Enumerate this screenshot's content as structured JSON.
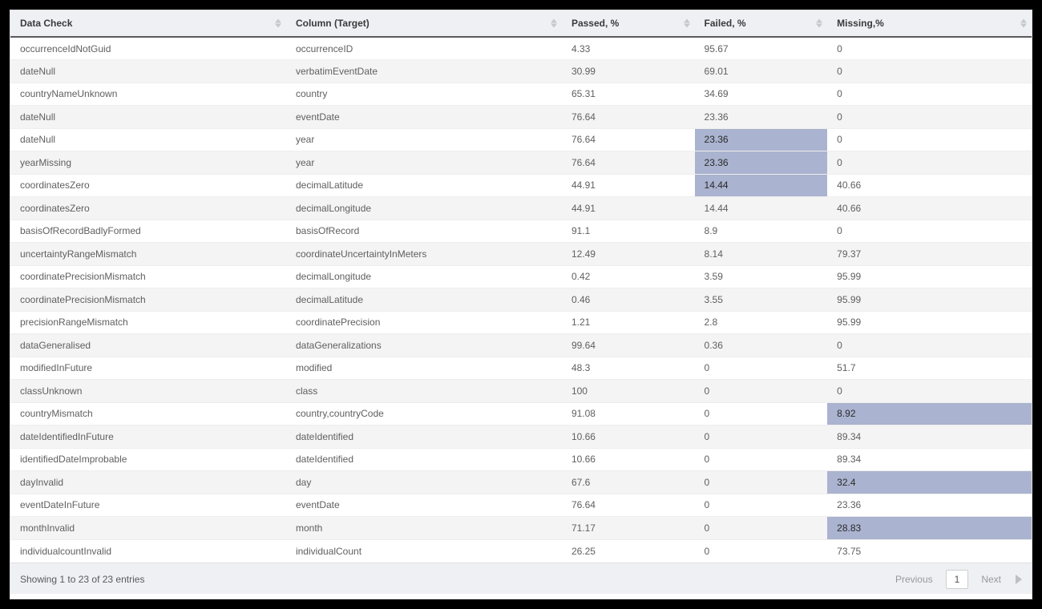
{
  "table": {
    "headers": {
      "data_check": "Data Check",
      "column_target": "Column (Target)",
      "passed": "Passed, %",
      "failed": "Failed, %",
      "missing": "Missing,%"
    },
    "rows": [
      {
        "data_check": "occurrenceIdNotGuid",
        "column_target": "occurrenceID",
        "passed": "4.33",
        "failed": "95.67",
        "missing": "0",
        "hl": []
      },
      {
        "data_check": "dateNull",
        "column_target": "verbatimEventDate",
        "passed": "30.99",
        "failed": "69.01",
        "missing": "0",
        "hl": []
      },
      {
        "data_check": "countryNameUnknown",
        "column_target": "country",
        "passed": "65.31",
        "failed": "34.69",
        "missing": "0",
        "hl": []
      },
      {
        "data_check": "dateNull",
        "column_target": "eventDate",
        "passed": "76.64",
        "failed": "23.36",
        "missing": "0",
        "hl": []
      },
      {
        "data_check": "dateNull",
        "column_target": "year",
        "passed": "76.64",
        "failed": "23.36",
        "missing": "0",
        "hl": [
          "failed"
        ]
      },
      {
        "data_check": "yearMissing",
        "column_target": "year",
        "passed": "76.64",
        "failed": "23.36",
        "missing": "0",
        "hl": [
          "failed"
        ]
      },
      {
        "data_check": "coordinatesZero",
        "column_target": "decimalLatitude",
        "passed": "44.91",
        "failed": "14.44",
        "missing": "40.66",
        "hl": [
          "failed"
        ]
      },
      {
        "data_check": "coordinatesZero",
        "column_target": "decimalLongitude",
        "passed": "44.91",
        "failed": "14.44",
        "missing": "40.66",
        "hl": []
      },
      {
        "data_check": "basisOfRecordBadlyFormed",
        "column_target": "basisOfRecord",
        "passed": "91.1",
        "failed": "8.9",
        "missing": "0",
        "hl": []
      },
      {
        "data_check": "uncertaintyRangeMismatch",
        "column_target": "coordinateUncertaintyInMeters",
        "passed": "12.49",
        "failed": "8.14",
        "missing": "79.37",
        "hl": []
      },
      {
        "data_check": "coordinatePrecisionMismatch",
        "column_target": "decimalLongitude",
        "passed": "0.42",
        "failed": "3.59",
        "missing": "95.99",
        "hl": []
      },
      {
        "data_check": "coordinatePrecisionMismatch",
        "column_target": "decimalLatitude",
        "passed": "0.46",
        "failed": "3.55",
        "missing": "95.99",
        "hl": []
      },
      {
        "data_check": "precisionRangeMismatch",
        "column_target": "coordinatePrecision",
        "passed": "1.21",
        "failed": "2.8",
        "missing": "95.99",
        "hl": []
      },
      {
        "data_check": "dataGeneralised",
        "column_target": "dataGeneralizations",
        "passed": "99.64",
        "failed": "0.36",
        "missing": "0",
        "hl": []
      },
      {
        "data_check": "modifiedInFuture",
        "column_target": "modified",
        "passed": "48.3",
        "failed": "0",
        "missing": "51.7",
        "hl": []
      },
      {
        "data_check": "classUnknown",
        "column_target": "class",
        "passed": "100",
        "failed": "0",
        "missing": "0",
        "hl": []
      },
      {
        "data_check": "countryMismatch",
        "column_target": "country,countryCode",
        "passed": "91.08",
        "failed": "0",
        "missing": "8.92",
        "hl": [
          "missing"
        ]
      },
      {
        "data_check": "dateIdentifiedInFuture",
        "column_target": "dateIdentified",
        "passed": "10.66",
        "failed": "0",
        "missing": "89.34",
        "hl": []
      },
      {
        "data_check": "identifiedDateImprobable",
        "column_target": "dateIdentified",
        "passed": "10.66",
        "failed": "0",
        "missing": "89.34",
        "hl": []
      },
      {
        "data_check": "dayInvalid",
        "column_target": "day",
        "passed": "67.6",
        "failed": "0",
        "missing": "32.4",
        "hl": [
          "missing"
        ]
      },
      {
        "data_check": "eventDateInFuture",
        "column_target": "eventDate",
        "passed": "76.64",
        "failed": "0",
        "missing": "23.36",
        "hl": []
      },
      {
        "data_check": "monthInvalid",
        "column_target": "month",
        "passed": "71.17",
        "failed": "0",
        "missing": "28.83",
        "hl": [
          "missing"
        ]
      },
      {
        "data_check": "individualcountInvalid",
        "column_target": "individualCount",
        "passed": "26.25",
        "failed": "0",
        "missing": "73.75",
        "hl": []
      }
    ]
  },
  "footer": {
    "info": "Showing 1 to 23 of 23 entries",
    "prev": "Previous",
    "page": "1",
    "next": "Next"
  }
}
